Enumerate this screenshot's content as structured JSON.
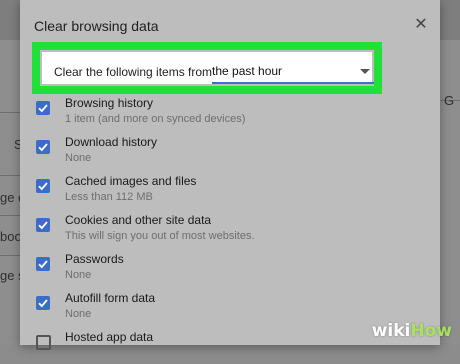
{
  "background": {
    "fragments": [
      "S",
      "ge ot",
      "boo",
      "ge su",
      "G"
    ]
  },
  "dialog": {
    "title": "Clear browsing data",
    "close_icon": "close-icon",
    "time_range": {
      "label": "Clear the following items from",
      "value": "the past hour"
    },
    "items": [
      {
        "title": "Browsing history",
        "description": "1 item (and more on synced devices)",
        "checked": true
      },
      {
        "title": "Download history",
        "description": "None",
        "checked": true
      },
      {
        "title": "Cached images and files",
        "description": "Less than 112 MB",
        "checked": true
      },
      {
        "title": "Cookies and other site data",
        "description": "This will sign you out of most websites.",
        "checked": true
      },
      {
        "title": "Passwords",
        "description": "None",
        "checked": true
      },
      {
        "title": "Autofill form data",
        "description": "None",
        "checked": true
      },
      {
        "title": "Hosted app data",
        "description": "",
        "checked": false
      }
    ]
  },
  "watermark": {
    "wiki": "wiki",
    "how": "How"
  },
  "colors": {
    "highlight": "#22e03a",
    "checkbox": "#3b6cc8",
    "select_underline": "#3f70c9"
  }
}
